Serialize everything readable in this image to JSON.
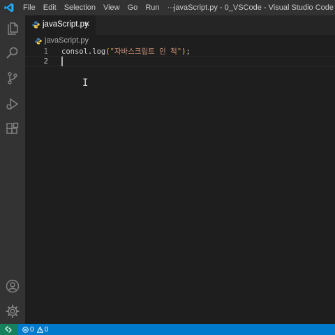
{
  "colors": {
    "titlebar_bg": "#323233",
    "activitybar_bg": "#333333",
    "editor_bg": "#1e1e1e",
    "statusbar_bg": "#007acc",
    "remote_bg": "#16825d",
    "string": "#ce9178",
    "bracket": "#ffd700"
  },
  "menu": {
    "items": [
      "File",
      "Edit",
      "Selection",
      "View",
      "Go",
      "Run",
      "···"
    ]
  },
  "window": {
    "title": "javaScript.py - 0_VSCode - Visual Studio Code"
  },
  "activity_bar": {
    "top_icons": [
      "files-icon",
      "search-icon",
      "source-control-icon",
      "run-debug-icon",
      "extensions-icon"
    ],
    "bottom_icons": [
      "account-icon",
      "settings-gear-icon"
    ]
  },
  "tab": {
    "label": "javaScript.py",
    "close": "✕"
  },
  "breadcrumb": {
    "file": "javaScript.py"
  },
  "editor": {
    "lines": [
      {
        "number": "1",
        "tokens": {
          "ident": "consol.log",
          "open": "(",
          "string": "\"자바스크립트 인 척\"",
          "close": ")",
          "semi": ";"
        }
      },
      {
        "number": "2",
        "tokens": {}
      }
    ]
  },
  "status_bar": {
    "errors": "0",
    "warnings": "0"
  }
}
